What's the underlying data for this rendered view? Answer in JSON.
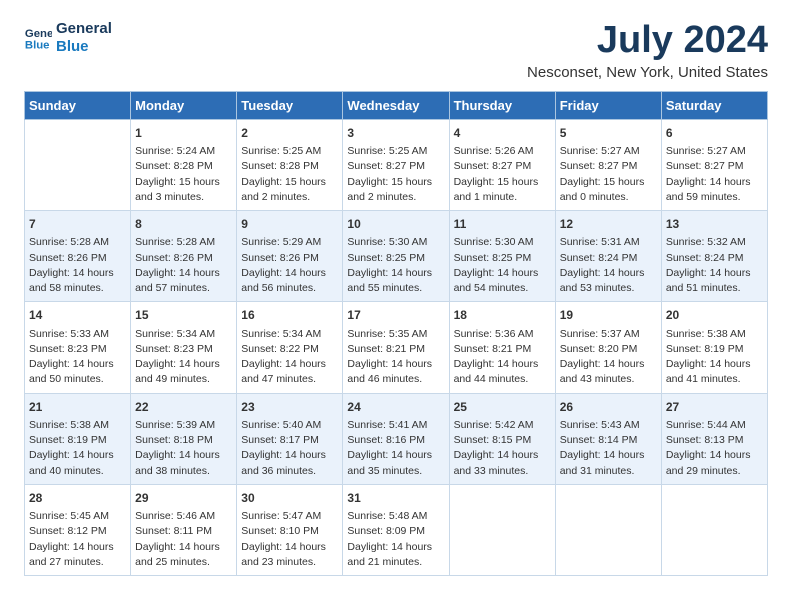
{
  "logo": {
    "line1": "General",
    "line2": "Blue"
  },
  "title": "July 2024",
  "subtitle": "Nesconset, New York, United States",
  "headers": [
    "Sunday",
    "Monday",
    "Tuesday",
    "Wednesday",
    "Thursday",
    "Friday",
    "Saturday"
  ],
  "weeks": [
    [
      {
        "day": "",
        "info": ""
      },
      {
        "day": "1",
        "info": "Sunrise: 5:24 AM\nSunset: 8:28 PM\nDaylight: 15 hours\nand 3 minutes."
      },
      {
        "day": "2",
        "info": "Sunrise: 5:25 AM\nSunset: 8:28 PM\nDaylight: 15 hours\nand 2 minutes."
      },
      {
        "day": "3",
        "info": "Sunrise: 5:25 AM\nSunset: 8:27 PM\nDaylight: 15 hours\nand 2 minutes."
      },
      {
        "day": "4",
        "info": "Sunrise: 5:26 AM\nSunset: 8:27 PM\nDaylight: 15 hours\nand 1 minute."
      },
      {
        "day": "5",
        "info": "Sunrise: 5:27 AM\nSunset: 8:27 PM\nDaylight: 15 hours\nand 0 minutes."
      },
      {
        "day": "6",
        "info": "Sunrise: 5:27 AM\nSunset: 8:27 PM\nDaylight: 14 hours\nand 59 minutes."
      }
    ],
    [
      {
        "day": "7",
        "info": "Sunrise: 5:28 AM\nSunset: 8:26 PM\nDaylight: 14 hours\nand 58 minutes."
      },
      {
        "day": "8",
        "info": "Sunrise: 5:28 AM\nSunset: 8:26 PM\nDaylight: 14 hours\nand 57 minutes."
      },
      {
        "day": "9",
        "info": "Sunrise: 5:29 AM\nSunset: 8:26 PM\nDaylight: 14 hours\nand 56 minutes."
      },
      {
        "day": "10",
        "info": "Sunrise: 5:30 AM\nSunset: 8:25 PM\nDaylight: 14 hours\nand 55 minutes."
      },
      {
        "day": "11",
        "info": "Sunrise: 5:30 AM\nSunset: 8:25 PM\nDaylight: 14 hours\nand 54 minutes."
      },
      {
        "day": "12",
        "info": "Sunrise: 5:31 AM\nSunset: 8:24 PM\nDaylight: 14 hours\nand 53 minutes."
      },
      {
        "day": "13",
        "info": "Sunrise: 5:32 AM\nSunset: 8:24 PM\nDaylight: 14 hours\nand 51 minutes."
      }
    ],
    [
      {
        "day": "14",
        "info": "Sunrise: 5:33 AM\nSunset: 8:23 PM\nDaylight: 14 hours\nand 50 minutes."
      },
      {
        "day": "15",
        "info": "Sunrise: 5:34 AM\nSunset: 8:23 PM\nDaylight: 14 hours\nand 49 minutes."
      },
      {
        "day": "16",
        "info": "Sunrise: 5:34 AM\nSunset: 8:22 PM\nDaylight: 14 hours\nand 47 minutes."
      },
      {
        "day": "17",
        "info": "Sunrise: 5:35 AM\nSunset: 8:21 PM\nDaylight: 14 hours\nand 46 minutes."
      },
      {
        "day": "18",
        "info": "Sunrise: 5:36 AM\nSunset: 8:21 PM\nDaylight: 14 hours\nand 44 minutes."
      },
      {
        "day": "19",
        "info": "Sunrise: 5:37 AM\nSunset: 8:20 PM\nDaylight: 14 hours\nand 43 minutes."
      },
      {
        "day": "20",
        "info": "Sunrise: 5:38 AM\nSunset: 8:19 PM\nDaylight: 14 hours\nand 41 minutes."
      }
    ],
    [
      {
        "day": "21",
        "info": "Sunrise: 5:38 AM\nSunset: 8:19 PM\nDaylight: 14 hours\nand 40 minutes."
      },
      {
        "day": "22",
        "info": "Sunrise: 5:39 AM\nSunset: 8:18 PM\nDaylight: 14 hours\nand 38 minutes."
      },
      {
        "day": "23",
        "info": "Sunrise: 5:40 AM\nSunset: 8:17 PM\nDaylight: 14 hours\nand 36 minutes."
      },
      {
        "day": "24",
        "info": "Sunrise: 5:41 AM\nSunset: 8:16 PM\nDaylight: 14 hours\nand 35 minutes."
      },
      {
        "day": "25",
        "info": "Sunrise: 5:42 AM\nSunset: 8:15 PM\nDaylight: 14 hours\nand 33 minutes."
      },
      {
        "day": "26",
        "info": "Sunrise: 5:43 AM\nSunset: 8:14 PM\nDaylight: 14 hours\nand 31 minutes."
      },
      {
        "day": "27",
        "info": "Sunrise: 5:44 AM\nSunset: 8:13 PM\nDaylight: 14 hours\nand 29 minutes."
      }
    ],
    [
      {
        "day": "28",
        "info": "Sunrise: 5:45 AM\nSunset: 8:12 PM\nDaylight: 14 hours\nand 27 minutes."
      },
      {
        "day": "29",
        "info": "Sunrise: 5:46 AM\nSunset: 8:11 PM\nDaylight: 14 hours\nand 25 minutes."
      },
      {
        "day": "30",
        "info": "Sunrise: 5:47 AM\nSunset: 8:10 PM\nDaylight: 14 hours\nand 23 minutes."
      },
      {
        "day": "31",
        "info": "Sunrise: 5:48 AM\nSunset: 8:09 PM\nDaylight: 14 hours\nand 21 minutes."
      },
      {
        "day": "",
        "info": ""
      },
      {
        "day": "",
        "info": ""
      },
      {
        "day": "",
        "info": ""
      }
    ]
  ]
}
